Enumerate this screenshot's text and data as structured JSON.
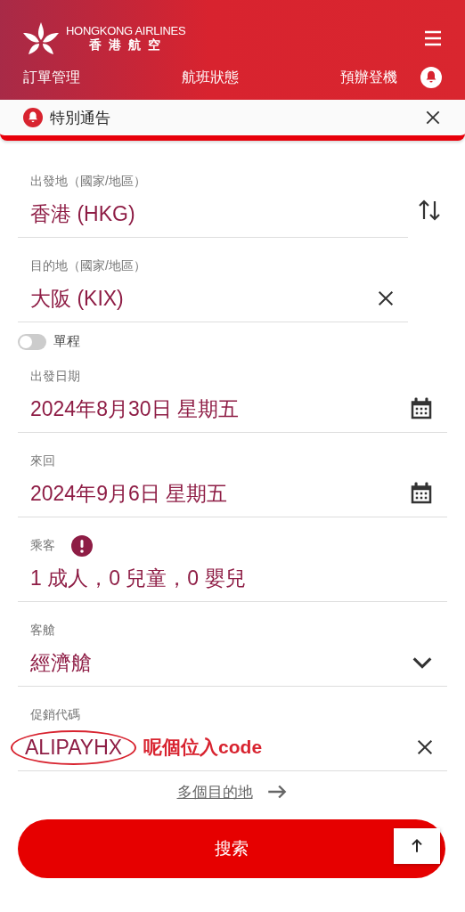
{
  "header": {
    "logo_en": "HONGKONG AIRLINES",
    "logo_zh": "香 港 航 空"
  },
  "nav": [
    {
      "label": "訂單管理"
    },
    {
      "label": "航班狀態"
    },
    {
      "label": "預辦登機"
    }
  ],
  "notice": {
    "label": "特別通告"
  },
  "fields": [
    {
      "kind": "origin",
      "label": "出發地（國家/地區）",
      "value": "香港 (HKG)"
    },
    {
      "kind": "destination",
      "label": "目的地（國家/地區）",
      "value": "大阪 (KIX)"
    },
    {
      "kind": "toggle",
      "label": "單程",
      "on": false
    },
    {
      "kind": "date",
      "label": "出發日期",
      "value": "2024年8月30日 星期五"
    },
    {
      "kind": "date",
      "label": "來回",
      "value": "2024年9月6日 星期五"
    },
    {
      "kind": "passengers",
      "label": "乘客",
      "value": "1 成人，0 兒童，0 嬰兒"
    },
    {
      "kind": "select",
      "label": "客艙",
      "value": "經濟艙"
    },
    {
      "kind": "promo",
      "label": "促銷代碼",
      "value": "ALIPAYHX",
      "annotation": "呢個位入code"
    }
  ],
  "multi_city": "多個目的地",
  "search_button": "搜索"
}
